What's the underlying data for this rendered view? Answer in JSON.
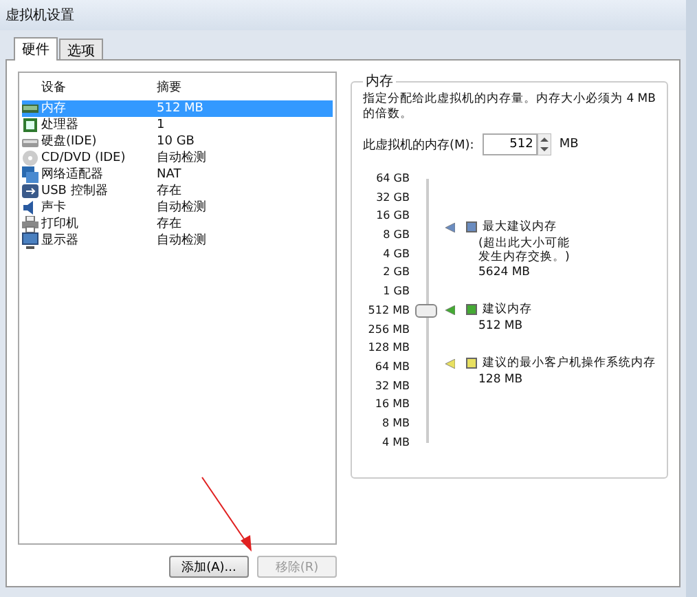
{
  "window": {
    "title": "虚拟机设置"
  },
  "tabs": [
    {
      "label": "硬件",
      "selected": true
    },
    {
      "label": "选项",
      "selected": false
    }
  ],
  "device_list": {
    "columns": [
      "设备",
      "摘要"
    ],
    "rows": [
      {
        "kind": "memory",
        "name": "内存",
        "summary": "512 MB",
        "selected": true
      },
      {
        "kind": "cpu",
        "name": "处理器",
        "summary": "1",
        "selected": false
      },
      {
        "kind": "disk",
        "name": "硬盘(IDE)",
        "summary": "10 GB",
        "selected": false
      },
      {
        "kind": "cdrom",
        "name": "CD/DVD (IDE)",
        "summary": "自动检测",
        "selected": false
      },
      {
        "kind": "network",
        "name": "网络适配器",
        "summary": "NAT",
        "selected": false
      },
      {
        "kind": "usb",
        "name": "USB 控制器",
        "summary": "存在",
        "selected": false
      },
      {
        "kind": "sound",
        "name": "声卡",
        "summary": "自动检测",
        "selected": false
      },
      {
        "kind": "printer",
        "name": "打印机",
        "summary": "存在",
        "selected": false
      },
      {
        "kind": "display",
        "name": "显示器",
        "summary": "自动检测",
        "selected": false
      }
    ]
  },
  "buttons": [
    {
      "label": "添加(A)...",
      "disabled": false
    },
    {
      "label": "移除(R)",
      "disabled": true
    }
  ],
  "memory": {
    "title": "内存",
    "description": "指定分配给此虚拟机的内存量。内存大小必须为 4 MB 的倍数。",
    "field_label": "此虚拟机的内存(M):",
    "value": "512",
    "unit": "MB",
    "scale": [
      "64 GB",
      "32 GB",
      "16 GB",
      "8 GB",
      "4 GB",
      "2 GB",
      "1 GB",
      "512 MB",
      "256 MB",
      "128 MB",
      "64 MB",
      "32 MB",
      "16 MB",
      "8 MB",
      "4 MB"
    ],
    "slider": {
      "level": 0.5
    },
    "legend": [
      {
        "label": "最大建议内存",
        "note": "(超出此大小可能发生内存交换。)",
        "value": "5624 MB",
        "color": "#6a8cc0"
      },
      {
        "label": "建议内存",
        "value": "512 MB",
        "color": "#44aa33"
      },
      {
        "label": "建议的最小客户机操作系统内存",
        "value": "128 MB",
        "color": "#e8e060"
      }
    ]
  }
}
